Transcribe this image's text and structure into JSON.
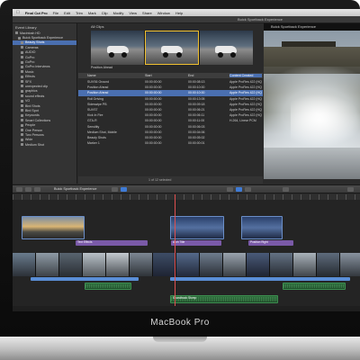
{
  "device": {
    "brand": "MacBook Pro"
  },
  "menubar": {
    "app_name": "Final Cut Pro",
    "items": [
      "File",
      "Edit",
      "Trim",
      "Mark",
      "Clip",
      "Modify",
      "View",
      "Share",
      "Window",
      "Help"
    ]
  },
  "window": {
    "title": "Buick Sportback Experience"
  },
  "library": {
    "title": "Event Library",
    "items": [
      {
        "label": "Macintosh HD",
        "selected": false
      },
      {
        "label": "Buick Sportback Experience",
        "selected": false
      },
      {
        "label": "Beauty Shots",
        "selected": true
      },
      {
        "label": "Cameras",
        "selected": false
      },
      {
        "label": "AUDIO",
        "selected": false
      },
      {
        "label": "GoPro",
        "selected": false
      },
      {
        "label": "GoPro",
        "selected": false
      },
      {
        "label": "GoPro Interviews",
        "selected": false
      },
      {
        "label": "Music",
        "selected": false
      },
      {
        "label": "Effects",
        "selected": false
      },
      {
        "label": "SFX",
        "selected": false
      },
      {
        "label": "unexpected clip",
        "selected": false
      },
      {
        "label": "graphics",
        "selected": false
      },
      {
        "label": "sound effects",
        "selected": false
      },
      {
        "label": "VO",
        "selected": false
      },
      {
        "label": "Bird Shots",
        "selected": false
      },
      {
        "label": "Bird Spot",
        "selected": false
      },
      {
        "label": "Keywords",
        "selected": false
      },
      {
        "label": "Smart Collections",
        "selected": false
      },
      {
        "label": "People",
        "selected": false
      },
      {
        "label": "One Person",
        "selected": false
      },
      {
        "label": "Two Persons",
        "selected": false
      },
      {
        "label": "Wide",
        "selected": false
      },
      {
        "label": "Medium Shot",
        "selected": false
      }
    ]
  },
  "browser": {
    "filter_label": "All Clips",
    "selected_clip_label": "Position Ahead",
    "columns": [
      "Name",
      "Start",
      "End",
      "Content Created"
    ],
    "rows": [
      {
        "name": "SUVS6 Ground",
        "start": "00:00:00:00",
        "end": "00:00:08:13",
        "info": "Apple ProRes 422 (HQ), Timecode",
        "selected": false
      },
      {
        "name": "Position Ahead",
        "start": "00:00:00:00",
        "end": "00:00:10:00",
        "info": "Apple ProRes 422 (HQ), Timecode",
        "selected": false
      },
      {
        "name": "Position Ahead",
        "start": "00:00:00:00",
        "end": "00:00:10:00",
        "info": "Apple ProRes 422 (HQ), Timecode",
        "selected": true
      },
      {
        "name": "Roll Driving",
        "start": "00:00:00:00",
        "end": "00:00:13:05",
        "info": "Apple ProRes 422 (HQ), Timecode",
        "selected": false
      },
      {
        "name": "Sideswipe PB",
        "start": "00:00:00:00",
        "end": "00:00:09:18",
        "info": "Apple ProRes 422 (HQ), Timecode",
        "selected": false
      },
      {
        "name": "SUVS7",
        "start": "00:00:00:00",
        "end": "00:00:06:21",
        "info": "Apple ProRes 422 (HQ), Timecode",
        "selected": false
      },
      {
        "name": "Kick In Fire",
        "start": "00:00:00:00",
        "end": "00:00:06:11",
        "info": "Apple ProRes 422 (HQ), Timecode",
        "selected": false
      },
      {
        "name": "GTA-R",
        "start": "00:00:00:00",
        "end": "00:00:11:00",
        "info": "H.264, Linear PCM",
        "selected": false
      },
      {
        "name": "Sensitity",
        "start": "00:00:00:00",
        "end": "00:00:06:03",
        "info": "",
        "selected": false
      },
      {
        "name": "Medium Shot, Mobile",
        "start": "00:00:00:00",
        "end": "00:00:04:06",
        "info": "",
        "selected": false
      },
      {
        "name": "Beauty Shots",
        "start": "00:00:00:00",
        "end": "00:00:05:02",
        "info": "",
        "selected": false
      },
      {
        "name": "Marker 1",
        "start": "00:00:00:00",
        "end": "00:00:00:01",
        "info": "",
        "selected": false
      }
    ],
    "footer": "1 of 12 selected"
  },
  "viewer": {
    "title": "Buick Sportback Experience"
  },
  "timeline": {
    "project_name": "Buick Sportback Experience",
    "clips": [
      {
        "label": "",
        "kind": "sky"
      },
      {
        "label": "",
        "kind": "blue"
      },
      {
        "label": "",
        "kind": "blue"
      }
    ],
    "title_clips": [
      "Text Effects",
      "Arch Title",
      "Position Right"
    ],
    "audio_label": "Soundtrack Stomp"
  },
  "colors": {
    "selection": "#4a6fb0",
    "accent_blue": "#3f7bd6",
    "audio_green": "#2c6a3a",
    "title_purple": "#7a5aa8",
    "playhead": "#e05050"
  }
}
